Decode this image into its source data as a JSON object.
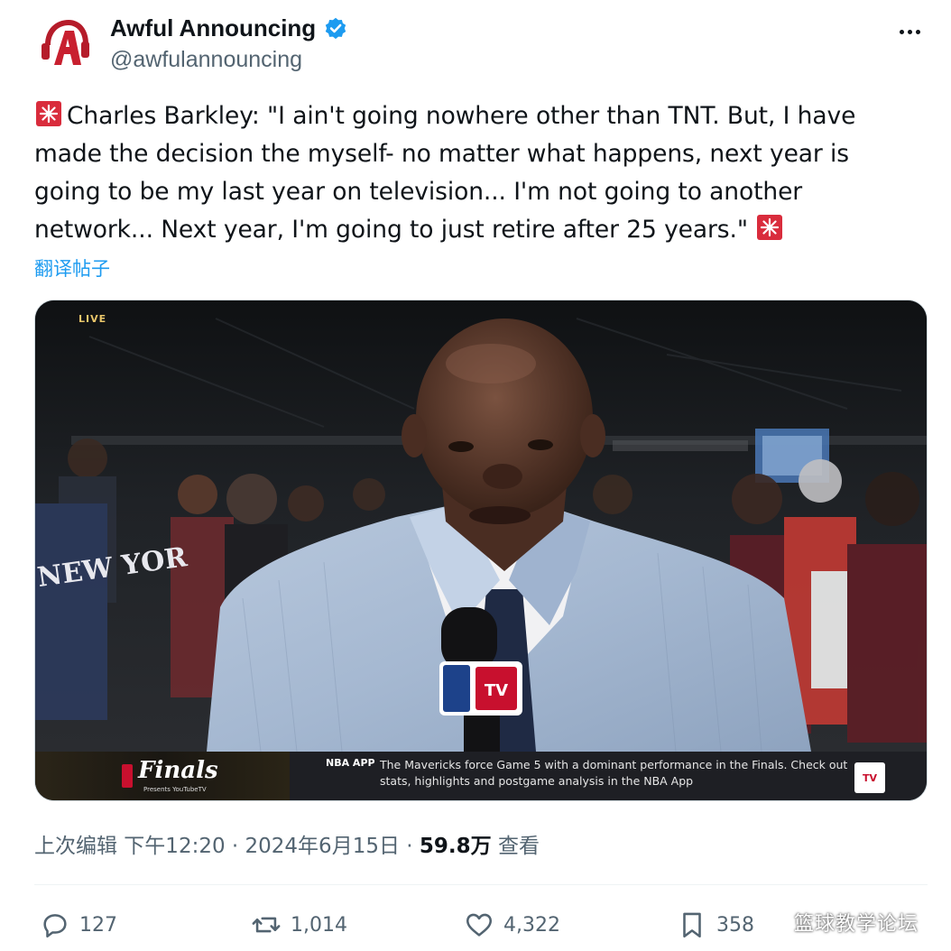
{
  "author": {
    "display_name": "Awful Announcing",
    "handle": "@awfulannouncing",
    "verified": true
  },
  "tweet": {
    "lines": [
      "Charles Barkley: \"I ain't going nowhere other than TNT. But, I have",
      "made the decision the myself- no matter what happens, next year is",
      "going to be my last year on television... I'm not going to another",
      "network... Next year, I'm going to just retire after 25 years.\""
    ],
    "translate_label": "翻译帖子"
  },
  "media": {
    "live_label": "LIVE",
    "jersey_text": "NEW YOR",
    "finals_label": "Finals",
    "finals_sub": "Presents YouTubeTV",
    "ticker_label": "NBA APP",
    "ticker_text": "The Mavericks force Game 5 with a dominant performance in the Finals. Check out stats, highlights and postgame analysis in the NBA App",
    "mic_flag_text": "TV",
    "ticker_logo_text": "TV"
  },
  "meta": {
    "edited_prefix": "上次编辑 下午12:20 · 2024年6月15日 · ",
    "views_count": "59.8万",
    "views_label": " 查看"
  },
  "actions": {
    "replies": "127",
    "reposts": "1,014",
    "likes": "4,322",
    "bookmarks": "358"
  },
  "watermark": "篮球教学论坛",
  "colors": {
    "link": "#1d9bf0",
    "secondary_text": "#536471",
    "verified_badge": "#1d9bf0",
    "brand_red": "#c8102e"
  }
}
